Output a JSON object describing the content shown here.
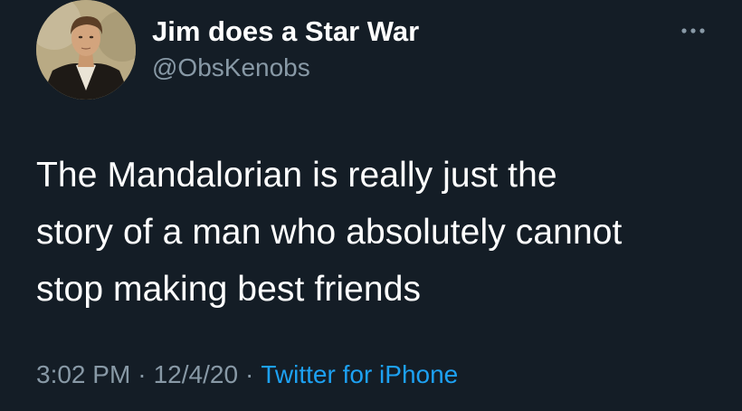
{
  "tweet": {
    "author": {
      "display_name": "Jim does a Star War",
      "handle": "@ObsKenobs",
      "avatar_icon": "profile-photo"
    },
    "more_icon": "more-options-icon",
    "text_lines": [
      "The Mandalorian is really just the",
      "story of a man who absolutely cannot",
      "stop making best friends"
    ],
    "meta": {
      "time": "3:02 PM",
      "separator": "·",
      "date": "12/4/20",
      "source": "Twitter for iPhone"
    }
  },
  "colors": {
    "background": "#141d26",
    "text": "#ffffff",
    "secondary": "#8899a6",
    "accent": "#1da1f2"
  }
}
